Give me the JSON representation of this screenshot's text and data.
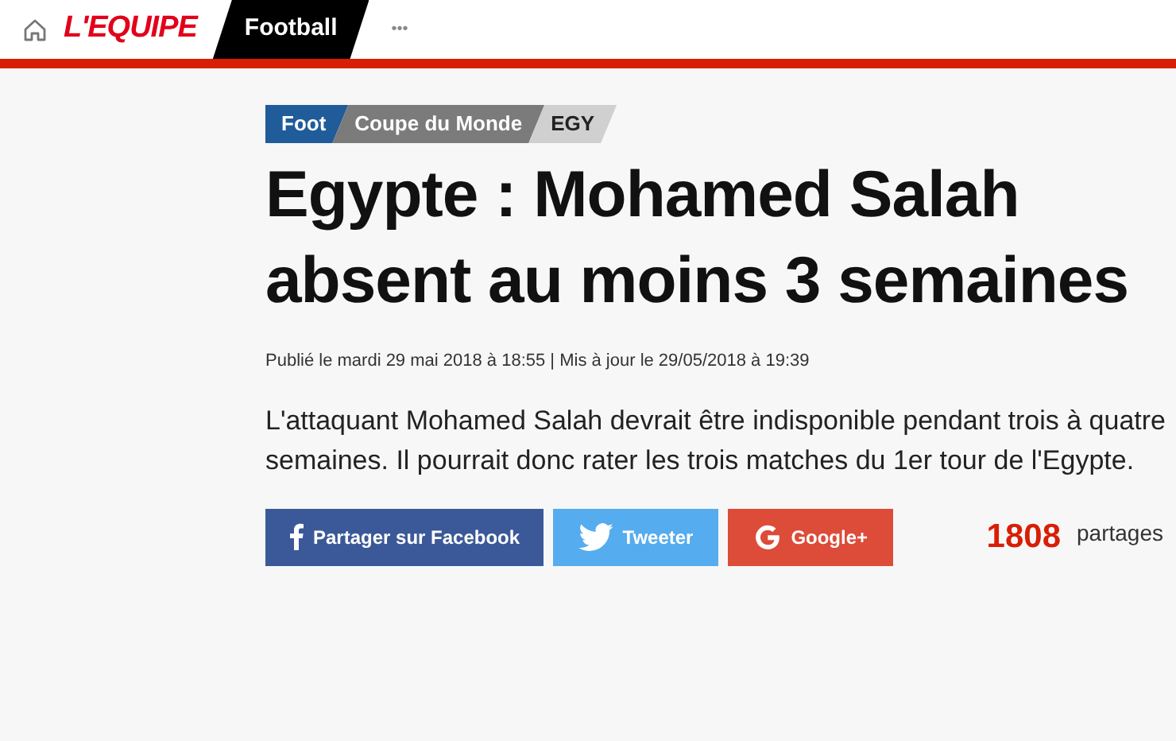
{
  "header": {
    "logo": "L'EQUIPE",
    "section": "Football",
    "more": "•••"
  },
  "breadcrumb": [
    {
      "label": "Foot",
      "color": "#1f5c99"
    },
    {
      "label": "Coupe du Monde",
      "color": "#7b7b7b"
    },
    {
      "label": "EGY",
      "color": "#d0d0d0"
    }
  ],
  "article": {
    "title": "Egypte : Mohamed Salah absent au moins 3 semaines",
    "meta": "Publié le mardi 29 mai 2018 à 18:55 | Mis à jour le 29/05/2018 à 19:39",
    "lead": "L'attaquant Mohamed Salah devrait être indisponible pendant trois à quatre semaines. Il pourrait donc rater les trois matches du 1er tour de l'Egypte."
  },
  "share": {
    "buttons": [
      {
        "kind": "facebook",
        "label": "Partager sur Facebook"
      },
      {
        "kind": "twitter",
        "label": "Tweeter"
      },
      {
        "kind": "google",
        "label": "Google+"
      }
    ],
    "count": "1808",
    "count_label": "partages"
  }
}
